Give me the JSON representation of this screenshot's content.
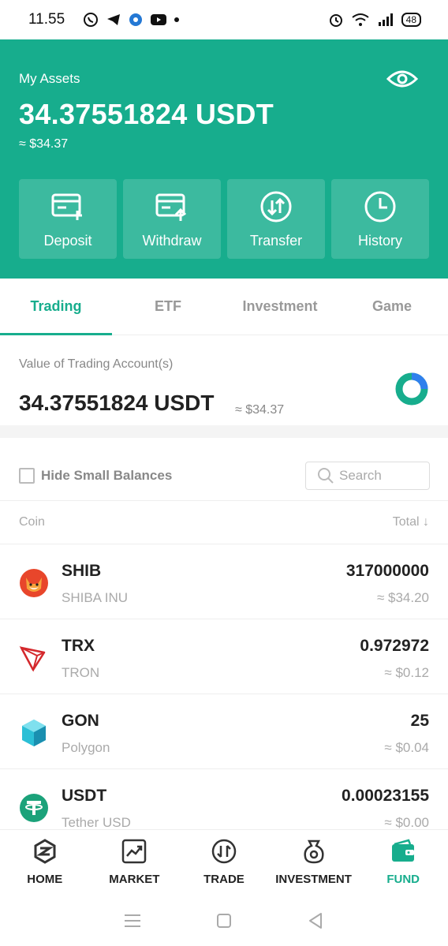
{
  "status_bar": {
    "time": "11.55",
    "battery": "48"
  },
  "assets": {
    "label": "My Assets",
    "amount": "34.37551824 USDT",
    "usd": "≈ $34.37",
    "actions": [
      {
        "label": "Deposit",
        "icon": "deposit-icon"
      },
      {
        "label": "Withdraw",
        "icon": "withdraw-icon"
      },
      {
        "label": "Transfer",
        "icon": "transfer-icon"
      },
      {
        "label": "History",
        "icon": "history-icon"
      }
    ]
  },
  "tabs": [
    {
      "label": "Trading",
      "active": true
    },
    {
      "label": "ETF"
    },
    {
      "label": "Investment"
    },
    {
      "label": "Game"
    }
  ],
  "account": {
    "label": "Value of Trading Account(s)",
    "amount": "34.37551824 USDT",
    "usd": "≈ $34.37"
  },
  "filter": {
    "hide_small_label": "Hide Small Balances",
    "search_placeholder": "Search"
  },
  "list_header": {
    "coin": "Coin",
    "total": "Total ↓"
  },
  "coins": [
    {
      "symbol": "SHIB",
      "name": "SHIBA INU",
      "amount": "317000000",
      "usd": "≈ $34.20",
      "icon": "shib-logo-icon"
    },
    {
      "symbol": "TRX",
      "name": "TRON",
      "amount": "0.972972",
      "usd": "≈ $0.12",
      "icon": "tron-logo-icon"
    },
    {
      "symbol": "GON",
      "name": "Polygon",
      "amount": "25",
      "usd": "≈ $0.04",
      "icon": "polygon-logo-icon"
    },
    {
      "symbol": "USDT",
      "name": "Tether USD",
      "amount": "0.00023155",
      "usd": "≈ $0.00",
      "icon": "tether-logo-icon"
    }
  ],
  "bottom_nav": [
    {
      "label": "HOME",
      "icon": "home-icon"
    },
    {
      "label": "MARKET",
      "icon": "market-icon"
    },
    {
      "label": "TRADE",
      "icon": "trade-icon"
    },
    {
      "label": "INVESTMENT",
      "icon": "investment-icon"
    },
    {
      "label": "FUND",
      "icon": "wallet-icon",
      "active": true
    }
  ],
  "colors": {
    "brand": "#17ad8d",
    "text": "#222222",
    "muted": "#aaaaaa"
  }
}
